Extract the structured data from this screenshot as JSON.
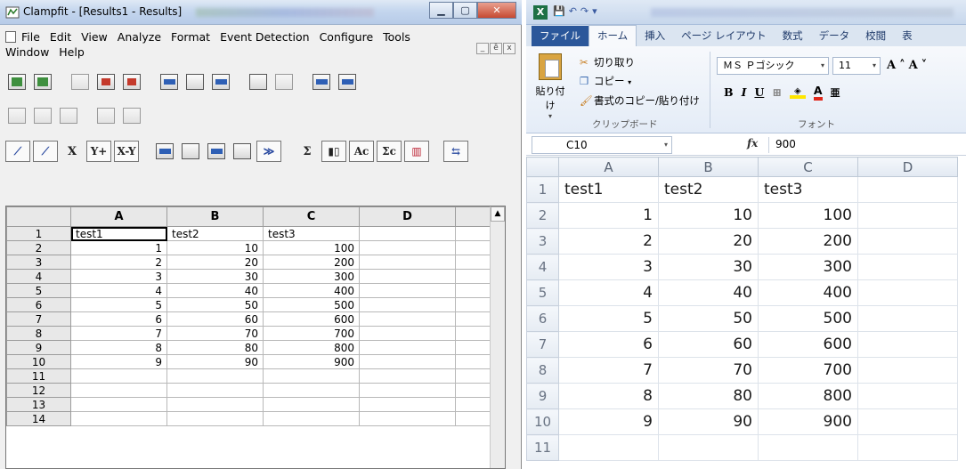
{
  "clampfit": {
    "title": "Clampfit - [Results1 - Results]",
    "menu": [
      "File",
      "Edit",
      "View",
      "Analyze",
      "Format",
      "Event Detection",
      "Configure",
      "Tools",
      "Window",
      "Help"
    ],
    "mdi_buttons": [
      "_",
      "ȅ",
      "x"
    ],
    "toolbar3_labels": [
      "X",
      "Y+",
      "X-Y",
      "Σ",
      "Ac",
      "Σc"
    ],
    "columns": [
      "A",
      "B",
      "C",
      "D",
      ""
    ],
    "rows": [
      {
        "n": "1",
        "a": "test1",
        "b": "test2",
        "c": "test3"
      },
      {
        "n": "2",
        "a": "1",
        "b": "10",
        "c": "100"
      },
      {
        "n": "3",
        "a": "2",
        "b": "20",
        "c": "200"
      },
      {
        "n": "4",
        "a": "3",
        "b": "30",
        "c": "300"
      },
      {
        "n": "5",
        "a": "4",
        "b": "40",
        "c": "400"
      },
      {
        "n": "6",
        "a": "5",
        "b": "50",
        "c": "500"
      },
      {
        "n": "7",
        "a": "6",
        "b": "60",
        "c": "600"
      },
      {
        "n": "8",
        "a": "7",
        "b": "70",
        "c": "700"
      },
      {
        "n": "9",
        "a": "8",
        "b": "80",
        "c": "800"
      },
      {
        "n": "10",
        "a": "9",
        "b": "90",
        "c": "900"
      },
      {
        "n": "11",
        "a": "",
        "b": "",
        "c": ""
      },
      {
        "n": "12",
        "a": "",
        "b": "",
        "c": ""
      },
      {
        "n": "13",
        "a": "",
        "b": "",
        "c": ""
      },
      {
        "n": "14",
        "a": "",
        "b": "",
        "c": ""
      }
    ]
  },
  "excel": {
    "tabs": [
      "ファイル",
      "ホーム",
      "挿入",
      "ページ レイアウト",
      "数式",
      "データ",
      "校閲",
      "表"
    ],
    "clipboard": {
      "paste": "貼り付け",
      "cut": "切り取り",
      "copy": "コピー",
      "format_painter": "書式のコピー/貼り付け",
      "group": "クリップボード"
    },
    "font": {
      "name": "ＭＳ Ｐゴシック",
      "size": "11",
      "group": "フォント"
    },
    "name_box": "C10",
    "formula": "900",
    "fx": "fx",
    "columns": [
      "A",
      "B",
      "C",
      "D"
    ],
    "rows": [
      {
        "n": "1",
        "a": "test1",
        "b": "test2",
        "c": "test3"
      },
      {
        "n": "2",
        "a": "1",
        "b": "10",
        "c": "100"
      },
      {
        "n": "3",
        "a": "2",
        "b": "20",
        "c": "200"
      },
      {
        "n": "4",
        "a": "3",
        "b": "30",
        "c": "300"
      },
      {
        "n": "5",
        "a": "4",
        "b": "40",
        "c": "400"
      },
      {
        "n": "6",
        "a": "5",
        "b": "50",
        "c": "500"
      },
      {
        "n": "7",
        "a": "6",
        "b": "60",
        "c": "600"
      },
      {
        "n": "8",
        "a": "7",
        "b": "70",
        "c": "700"
      },
      {
        "n": "9",
        "a": "8",
        "b": "80",
        "c": "800"
      },
      {
        "n": "10",
        "a": "9",
        "b": "90",
        "c": "900"
      },
      {
        "n": "11",
        "a": "",
        "b": "",
        "c": ""
      }
    ]
  }
}
